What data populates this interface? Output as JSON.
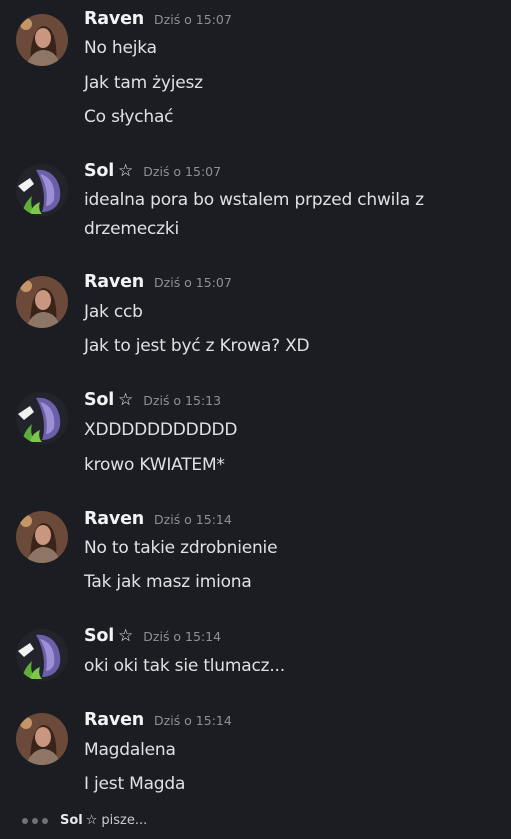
{
  "colors": {
    "background": "#1c1d22",
    "username": "#f2f3f5",
    "message_text": "#dfe1e5",
    "timestamp": "#8d9099"
  },
  "groups": [
    {
      "author": "Raven",
      "has_star": false,
      "avatar": "raven-avatar",
      "timestamp": "Dziś o 15:07",
      "messages": [
        "No hejka",
        "Jak tam żyjesz",
        "Co słychać"
      ]
    },
    {
      "author": "Sol",
      "has_star": true,
      "star_icon": "☆",
      "avatar": "sol-avatar",
      "timestamp": "Dziś o 15:07",
      "messages": [
        "idealna pora bo wstalem prpzed chwila z drzemeczki"
      ]
    },
    {
      "author": "Raven",
      "has_star": false,
      "avatar": "raven-avatar",
      "timestamp": "Dziś o 15:07",
      "messages": [
        "Jak ccb",
        "Jak to jest być z Krowa? XD"
      ]
    },
    {
      "author": "Sol",
      "has_star": true,
      "star_icon": "☆",
      "avatar": "sol-avatar",
      "timestamp": "Dziś o 15:13",
      "messages": [
        "XDDDDDDDDDDD",
        "krowo KWIATEM*"
      ]
    },
    {
      "author": "Raven",
      "has_star": false,
      "avatar": "raven-avatar",
      "timestamp": "Dziś o 15:14",
      "messages": [
        "No to takie zdrobnienie",
        "Tak jak masz imiona"
      ]
    },
    {
      "author": "Sol",
      "has_star": true,
      "star_icon": "☆",
      "avatar": "sol-avatar",
      "timestamp": "Dziś o 15:14",
      "messages": [
        "oki oki tak sie tlumacz..."
      ]
    },
    {
      "author": "Raven",
      "has_star": false,
      "avatar": "raven-avatar",
      "timestamp": "Dziś o 15:14",
      "messages": [
        "Magdalena",
        "I jest Magda"
      ]
    }
  ],
  "typing": {
    "name": "Sol",
    "star_icon": "☆",
    "text": "pisze..."
  }
}
